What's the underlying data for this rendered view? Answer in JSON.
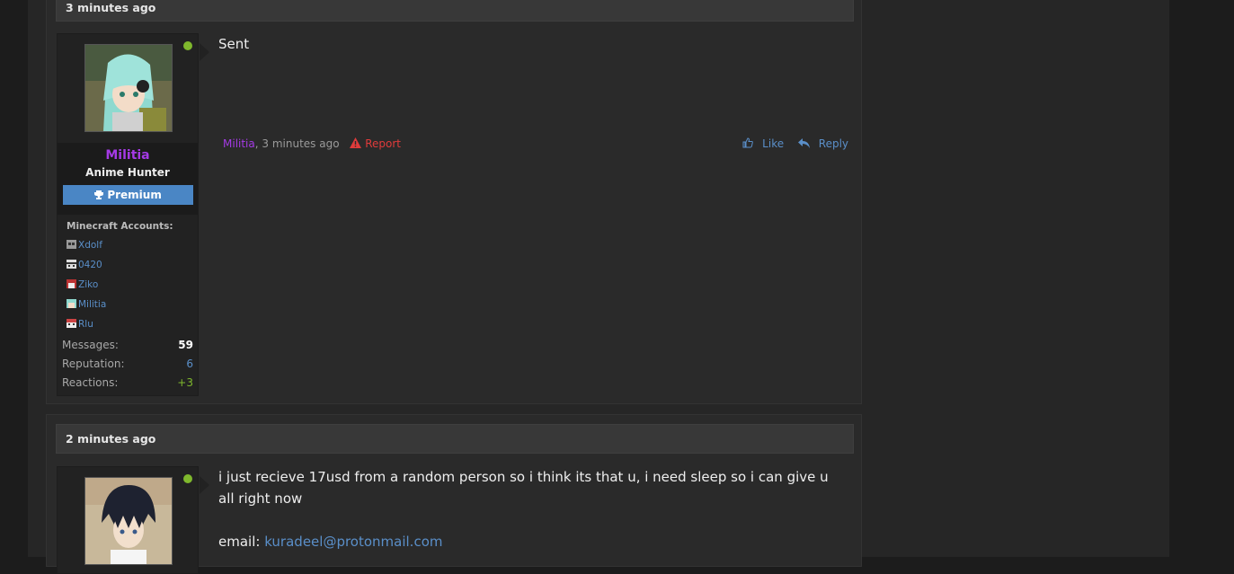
{
  "colors": {
    "accent": "#5a8fc9",
    "username": "#a53ae6",
    "online": "#7fb82d",
    "report": "#e03b3b",
    "banner": "#4a86c5"
  },
  "post1": {
    "time": "3 minutes ago",
    "user": {
      "name": "Militia",
      "title": "Anime Hunter",
      "banner": "Premium",
      "banner_icon": "trophy-icon",
      "mc_title": "Minecraft Accounts:",
      "mc_accounts": [
        "Xdolf",
        "0420",
        "Ziko",
        "Militia",
        "Rlu"
      ],
      "stats": [
        {
          "label": "Messages:",
          "value": "59"
        },
        {
          "label": "Reputation:",
          "value": "6"
        },
        {
          "label": "Reactions:",
          "value": "+3"
        }
      ]
    },
    "message": "Sent",
    "meta_author": "Militia",
    "meta_time": ", 3 minutes ago",
    "report": "Report",
    "like": "Like",
    "reply": "Reply"
  },
  "post2": {
    "time": "2 minutes ago",
    "message_line1": "i just recieve 17usd from a random person so i think its that u, i need sleep so i can give u",
    "message_line2": "all right now",
    "email_label": "email:",
    "email": "kuradeel@protonmail.com"
  }
}
